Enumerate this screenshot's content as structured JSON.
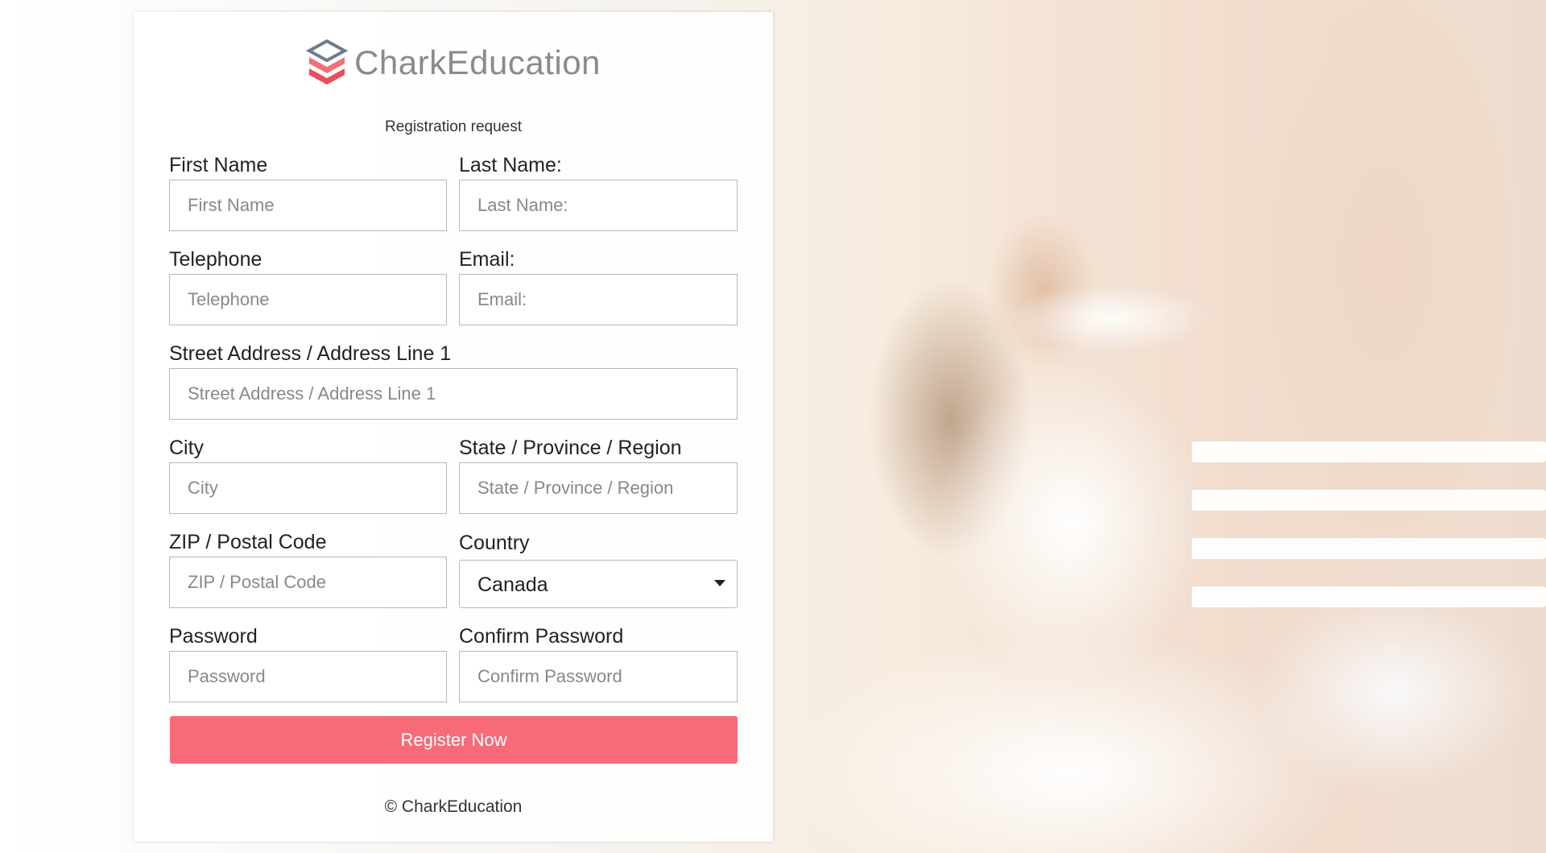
{
  "brand": {
    "name": "CharkEducation",
    "accent_color": "#f76b78",
    "logo_icon": "stacked-layers-icon"
  },
  "form": {
    "subtitle": "Registration request",
    "fields": {
      "first_name": {
        "label": "First Name",
        "placeholder": "First Name"
      },
      "last_name": {
        "label": "Last Name:",
        "placeholder": "Last Name:"
      },
      "telephone": {
        "label": "Telephone",
        "placeholder": "Telephone"
      },
      "email": {
        "label": "Email:",
        "placeholder": "Email:"
      },
      "street": {
        "label": "Street Address / Address Line 1",
        "placeholder": "Street Address / Address Line 1"
      },
      "city": {
        "label": "City",
        "placeholder": "City"
      },
      "state": {
        "label": "State / Province / Region",
        "placeholder": "State / Province / Region"
      },
      "zip": {
        "label": "ZIP / Postal Code",
        "placeholder": "ZIP / Postal Code"
      },
      "country": {
        "label": "Country",
        "value": "Canada"
      },
      "password": {
        "label": "Password",
        "placeholder": "Password"
      },
      "confirm_password": {
        "label": "Confirm Password",
        "placeholder": "Confirm Password"
      }
    },
    "submit_label": "Register Now"
  },
  "footer": {
    "copyright": "© CharkEducation"
  }
}
